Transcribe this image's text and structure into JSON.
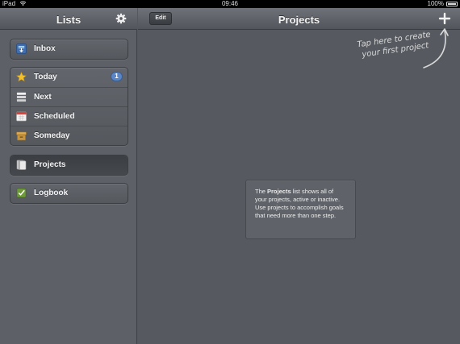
{
  "status": {
    "device": "iPad",
    "time": "09:46",
    "battery": "100%"
  },
  "sidebar": {
    "title": "Lists",
    "groups": [
      {
        "items": [
          {
            "label": "Inbox",
            "icon": "inbox-icon"
          }
        ]
      },
      {
        "items": [
          {
            "label": "Today",
            "icon": "star-icon",
            "badge": "1"
          },
          {
            "label": "Next",
            "icon": "list-icon"
          },
          {
            "label": "Scheduled",
            "icon": "calendar-icon"
          },
          {
            "label": "Someday",
            "icon": "box-icon"
          }
        ]
      },
      {
        "items": [
          {
            "label": "Projects",
            "icon": "projects-icon",
            "selected": true
          }
        ]
      },
      {
        "items": [
          {
            "label": "Logbook",
            "icon": "logbook-icon"
          }
        ]
      }
    ]
  },
  "main": {
    "edit_label": "Edit",
    "title": "Projects",
    "hint_line1": "Tap here to create",
    "hint_line2": "your first project",
    "info": {
      "pre": "The ",
      "bold": "Projects",
      "post": " list shows all of your projects, active or inactive. Use projects to accomplish goals that need more than one step."
    }
  },
  "colors": {
    "background": "#55595f",
    "badge": "#5a86c8",
    "accent_star": "#f2c02e"
  }
}
